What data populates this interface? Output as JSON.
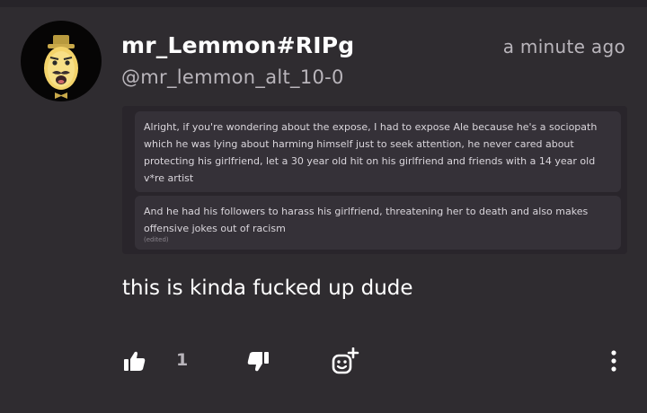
{
  "post": {
    "author_name": "mr_Lemmon#RIPg",
    "handle": "@mr_lemmon_alt_10-0",
    "timestamp": "a minute ago",
    "body": "this is kinda fucked up dude",
    "like_count": "1"
  },
  "quoted_image": {
    "messages": [
      {
        "text": "Alright, if you're wondering about the expose, I had to expose Ale because he's a sociopath which he was lying about harming himself just to seek attention, he never cared about protecting his girlfriend, let a 30 year old hit on his girlfriend and friends with a 14 year old v*re artist"
      },
      {
        "text": "And he had his followers to harass his girlfriend, threatening her to death and also makes offensive jokes out of racism",
        "edited_label": "(edited)"
      }
    ]
  },
  "actions": {
    "like_icon": "thumbs-up-icon",
    "dislike_icon": "thumbs-down-icon",
    "react_icon": "add-emoji-icon",
    "more_icon": "more-vertical-icon"
  },
  "colors": {
    "background": "#2f2c30",
    "primary_text": "#ffffff",
    "secondary_text": "#b9b5bb",
    "avatar_yellow": "#f3d36a"
  }
}
